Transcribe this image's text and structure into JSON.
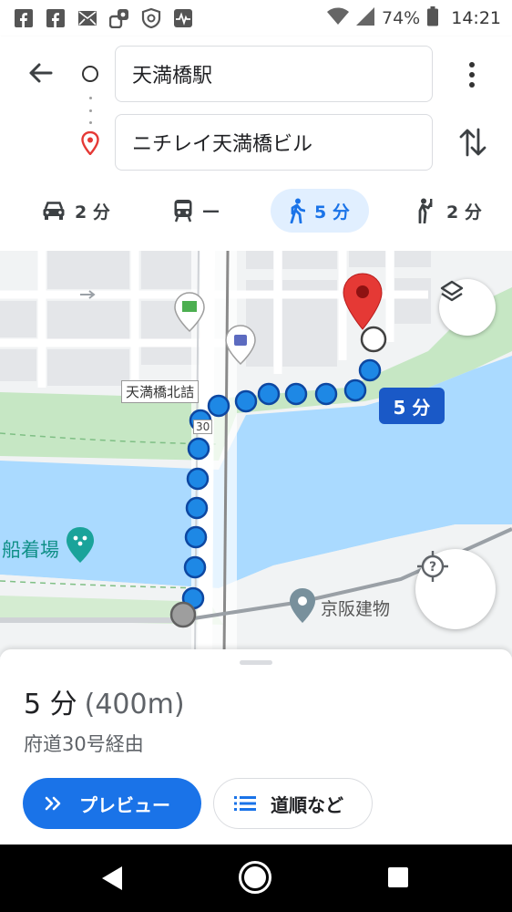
{
  "status_bar": {
    "battery": "74%",
    "time": "14:21",
    "notification_icons": [
      "facebook-icon",
      "facebook-icon",
      "mail-icon",
      "app-icon",
      "shield-icon",
      "activity-icon"
    ]
  },
  "directions": {
    "origin": "天満橋駅",
    "destination": "ニチレイ天満橋ビル",
    "modes": [
      {
        "name": "car",
        "value": "2 分"
      },
      {
        "name": "transit",
        "value": "—"
      },
      {
        "name": "walk",
        "value": "5 分",
        "selected": true
      },
      {
        "name": "ride",
        "value": "2 分"
      }
    ]
  },
  "map": {
    "labels": {
      "intersection": "天満橋北詰",
      "pier": "船着場",
      "place": "京阪建物",
      "route_shield": "30"
    },
    "route_time": "5 分",
    "colors": {
      "route": "#1e88e5",
      "water": "#aadaff",
      "park": "#c8e6c9",
      "pin": "#e53935"
    }
  },
  "sheet": {
    "duration": "5 分",
    "distance": "(400m)",
    "via": "府道30号経由",
    "preview_label": "プレビュー",
    "steps_label": "道順など"
  }
}
